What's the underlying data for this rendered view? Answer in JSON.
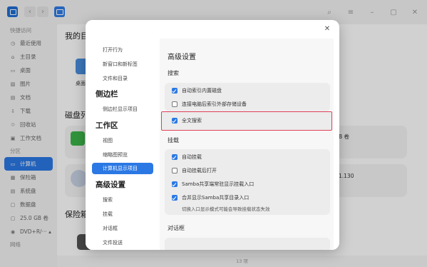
{
  "sidebar": {
    "quick_access": "快捷访问",
    "items_top": [
      {
        "icon": "clock-icon",
        "glyph": "◷",
        "label": "最近使用"
      },
      {
        "icon": "home-icon",
        "glyph": "⌂",
        "label": "主目录"
      },
      {
        "icon": "desktop-icon",
        "glyph": "▭",
        "label": "桌面"
      },
      {
        "icon": "image-icon",
        "glyph": "▨",
        "label": "图片"
      },
      {
        "icon": "document-icon",
        "glyph": "▤",
        "label": "文档"
      },
      {
        "icon": "download-icon",
        "glyph": "⇩",
        "label": "下载"
      },
      {
        "icon": "trash-icon",
        "glyph": "♲",
        "label": "回收站"
      },
      {
        "icon": "folder-icon",
        "glyph": "▣",
        "label": "工作文档"
      }
    ],
    "partition_head": "分区",
    "items_bottom": [
      {
        "icon": "computer-icon",
        "glyph": "▭",
        "label": "计算机",
        "active": true
      },
      {
        "icon": "safe-icon",
        "glyph": "▦",
        "label": "保险箱"
      },
      {
        "icon": "system-disk-icon",
        "glyph": "▤",
        "label": "系统盘"
      },
      {
        "icon": "data-disk-icon",
        "glyph": "▢",
        "label": "数据盘"
      },
      {
        "icon": "volume-icon",
        "glyph": "▢",
        "label": "25.0 GB 卷"
      },
      {
        "icon": "dvd-icon",
        "glyph": "◉",
        "label": "DVD+R/··· ▴"
      }
    ],
    "network_head": "网络"
  },
  "main": {
    "my_dirs": "我的目",
    "desktop_label": "桌面",
    "disk_list": "磁盘列",
    "disk_size_frag": "B 卷",
    "disk_ip_frag": "1.130",
    "safe_title": "保险箱",
    "status": "13 项"
  },
  "dialog": {
    "nav": {
      "group1_items": [
        "打开行为",
        "新窗口和新标签",
        "文件和目录"
      ],
      "group2": "侧边栏",
      "group2_items": [
        "侧边栏显示项目"
      ],
      "group3": "工作区",
      "group3_items": [
        "视图",
        "缩略图预览",
        "计算机显示项目"
      ],
      "group4": "高级设置",
      "group4_items": [
        "搜索",
        "挂载",
        "对话框",
        "文件投送"
      ]
    },
    "content": {
      "title": "高级设置",
      "search_head": "搜索",
      "search_opts": [
        {
          "label": "自动索引内置磁盘",
          "checked": true
        },
        {
          "label": "连接电脑后索引外部存储设备",
          "checked": false
        }
      ],
      "fulltext": {
        "label": "全文搜索",
        "checked": true
      },
      "mount_head": "挂载",
      "mount_opts": [
        {
          "label": "自动挂载",
          "checked": true
        },
        {
          "label": "自动挂载后打开",
          "checked": false
        },
        {
          "label": "Samba共享端常驻显示挂载入口",
          "checked": true
        },
        {
          "label": "合并显示Samba共享目录入口",
          "checked": true
        }
      ],
      "mount_note": "切换入口显示模式可能会导致挂载状态失效",
      "dialog_head": "对话框"
    }
  },
  "colors": {
    "accent": "#2b78e4",
    "highlight_border": "#e0405a"
  }
}
